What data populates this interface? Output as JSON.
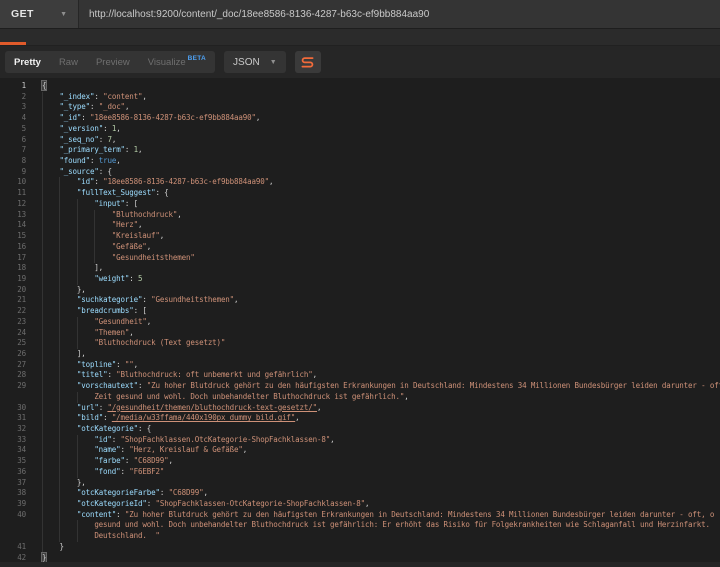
{
  "request": {
    "method": "GET",
    "url": "http://localhost:9200/content/_doc/18ee8586-8136-4287-b63c-ef9bb884aa90"
  },
  "response_toolbar": {
    "tabs": [
      {
        "label": "Pretty",
        "active": true
      },
      {
        "label": "Raw"
      },
      {
        "label": "Preview"
      },
      {
        "label": "Visualize",
        "badge": "BETA"
      }
    ],
    "format": "JSON",
    "beautify_icon": "beautify-icon"
  },
  "colors": {
    "accent_orange": "#e05b2b",
    "beta_blue": "#4ea1f3",
    "json_key": "#9cdcfe",
    "json_string": "#ce9178",
    "json_number": "#b5cea8",
    "json_boolean": "#569cd6",
    "otc_farbe_value": "C68D99",
    "otc_fond_value": "F6EBF2"
  },
  "editor": {
    "rows": [
      {
        "n": "1",
        "ind": 0,
        "active": true,
        "seg": [
          [
            "pm",
            "{"
          ]
        ]
      },
      {
        "n": "2",
        "ind": 1,
        "seg": [
          [
            "k",
            "\"_index\""
          ],
          [
            "p",
            ": "
          ],
          [
            "s",
            "\"content\""
          ],
          [
            "p",
            ","
          ]
        ]
      },
      {
        "n": "3",
        "ind": 1,
        "seg": [
          [
            "k",
            "\"_type\""
          ],
          [
            "p",
            ": "
          ],
          [
            "s",
            "\"_doc\""
          ],
          [
            "p",
            ","
          ]
        ]
      },
      {
        "n": "4",
        "ind": 1,
        "seg": [
          [
            "k",
            "\"_id\""
          ],
          [
            "p",
            ": "
          ],
          [
            "s",
            "\"18ee8586-8136-4287-b63c-ef9bb884aa90\""
          ],
          [
            "p",
            ","
          ]
        ]
      },
      {
        "n": "5",
        "ind": 1,
        "seg": [
          [
            "k",
            "\"_version\""
          ],
          [
            "p",
            ": "
          ],
          [
            "n",
            "1"
          ],
          [
            "p",
            ","
          ]
        ]
      },
      {
        "n": "6",
        "ind": 1,
        "seg": [
          [
            "k",
            "\"_seq_no\""
          ],
          [
            "p",
            ": "
          ],
          [
            "n",
            "7"
          ],
          [
            "p",
            ","
          ]
        ]
      },
      {
        "n": "7",
        "ind": 1,
        "seg": [
          [
            "k",
            "\"_primary_term\""
          ],
          [
            "p",
            ": "
          ],
          [
            "n",
            "1"
          ],
          [
            "p",
            ","
          ]
        ]
      },
      {
        "n": "8",
        "ind": 1,
        "seg": [
          [
            "k",
            "\"found\""
          ],
          [
            "p",
            ": "
          ],
          [
            "b",
            "true"
          ],
          [
            "p",
            ","
          ]
        ]
      },
      {
        "n": "9",
        "ind": 1,
        "seg": [
          [
            "k",
            "\"_source\""
          ],
          [
            "p",
            ": {"
          ]
        ]
      },
      {
        "n": "10",
        "ind": 2,
        "seg": [
          [
            "k",
            "\"id\""
          ],
          [
            "p",
            ": "
          ],
          [
            "s",
            "\"18ee8586-8136-4287-b63c-ef9bb884aa90\""
          ],
          [
            "p",
            ","
          ]
        ]
      },
      {
        "n": "11",
        "ind": 2,
        "seg": [
          [
            "k",
            "\"fullText_Suggest\""
          ],
          [
            "p",
            ": {"
          ]
        ]
      },
      {
        "n": "12",
        "ind": 3,
        "seg": [
          [
            "k",
            "\"input\""
          ],
          [
            "p",
            ": ["
          ]
        ]
      },
      {
        "n": "13",
        "ind": 4,
        "seg": [
          [
            "s",
            "\"Bluthochdruck\""
          ],
          [
            "p",
            ","
          ]
        ]
      },
      {
        "n": "14",
        "ind": 4,
        "seg": [
          [
            "s",
            "\"Herz\""
          ],
          [
            "p",
            ","
          ]
        ]
      },
      {
        "n": "15",
        "ind": 4,
        "seg": [
          [
            "s",
            "\"Kreislauf\""
          ],
          [
            "p",
            ","
          ]
        ]
      },
      {
        "n": "16",
        "ind": 4,
        "seg": [
          [
            "s",
            "\"Gefäße\""
          ],
          [
            "p",
            ","
          ]
        ]
      },
      {
        "n": "17",
        "ind": 4,
        "seg": [
          [
            "s",
            "\"Gesundheitsthemen\""
          ]
        ]
      },
      {
        "n": "18",
        "ind": 3,
        "seg": [
          [
            "p",
            "],"
          ]
        ]
      },
      {
        "n": "19",
        "ind": 3,
        "seg": [
          [
            "k",
            "\"weight\""
          ],
          [
            "p",
            ": "
          ],
          [
            "n",
            "5"
          ]
        ]
      },
      {
        "n": "20",
        "ind": 2,
        "seg": [
          [
            "p",
            "},"
          ]
        ]
      },
      {
        "n": "21",
        "ind": 2,
        "seg": [
          [
            "k",
            "\"suchkategorie\""
          ],
          [
            "p",
            ": "
          ],
          [
            "s",
            "\"Gesundheitsthemen\""
          ],
          [
            "p",
            ","
          ]
        ]
      },
      {
        "n": "22",
        "ind": 2,
        "seg": [
          [
            "k",
            "\"breadcrumbs\""
          ],
          [
            "p",
            ": ["
          ]
        ]
      },
      {
        "n": "23",
        "ind": 3,
        "seg": [
          [
            "s",
            "\"Gesundheit\""
          ],
          [
            "p",
            ","
          ]
        ]
      },
      {
        "n": "24",
        "ind": 3,
        "seg": [
          [
            "s",
            "\"Themen\""
          ],
          [
            "p",
            ","
          ]
        ]
      },
      {
        "n": "25",
        "ind": 3,
        "seg": [
          [
            "s",
            "\"Bluthochdruck (Text gesetzt)\""
          ]
        ]
      },
      {
        "n": "26",
        "ind": 2,
        "seg": [
          [
            "p",
            "],"
          ]
        ]
      },
      {
        "n": "27",
        "ind": 2,
        "seg": [
          [
            "k",
            "\"topline\""
          ],
          [
            "p",
            ": "
          ],
          [
            "s",
            "\"\""
          ],
          [
            "p",
            ","
          ]
        ]
      },
      {
        "n": "28",
        "ind": 2,
        "seg": [
          [
            "k",
            "\"titel\""
          ],
          [
            "p",
            ": "
          ],
          [
            "s",
            "\"Bluthochdruck: oft unbemerkt und gefährlich\""
          ],
          [
            "p",
            ","
          ]
        ]
      },
      {
        "n": "29",
        "ind": 2,
        "seg": [
          [
            "k",
            "\"vorschautext\""
          ],
          [
            "p",
            ": "
          ],
          [
            "s",
            "\"Zu hoher Blutdruck gehört zu den häufigsten Erkrankungen in Deutschland: Mindestens 34 Millionen Bundesbürger leiden darunter - oft"
          ]
        ]
      },
      {
        "n": "",
        "ind": 3,
        "seg": [
          [
            "s",
            "Zeit gesund und wohl. Doch unbehandelter Bluthochdruck ist gefährlich.\""
          ],
          [
            "p",
            ","
          ]
        ]
      },
      {
        "n": "30",
        "ind": 2,
        "seg": [
          [
            "k",
            "\"url\""
          ],
          [
            "p",
            ": "
          ],
          [
            "u",
            "\"/gesundheit/themen/bluthochdruck-text-gesetzt/\""
          ],
          [
            "p",
            ","
          ]
        ]
      },
      {
        "n": "31",
        "ind": 2,
        "seg": [
          [
            "k",
            "\"bild\""
          ],
          [
            "p",
            ": "
          ],
          [
            "u",
            "\"/media/w33ffama/440x190px_dummy_bild.gif\""
          ],
          [
            "p",
            ","
          ]
        ]
      },
      {
        "n": "32",
        "ind": 2,
        "seg": [
          [
            "k",
            "\"otcKategorie\""
          ],
          [
            "p",
            ": {"
          ]
        ]
      },
      {
        "n": "33",
        "ind": 3,
        "seg": [
          [
            "k",
            "\"id\""
          ],
          [
            "p",
            ": "
          ],
          [
            "s",
            "\"ShopFachklassen.OtcKategorie-ShopFachklassen-8\""
          ],
          [
            "p",
            ","
          ]
        ]
      },
      {
        "n": "34",
        "ind": 3,
        "seg": [
          [
            "k",
            "\"name\""
          ],
          [
            "p",
            ": "
          ],
          [
            "s",
            "\"Herz, Kreislauf & Gefäße\""
          ],
          [
            "p",
            ","
          ]
        ]
      },
      {
        "n": "35",
        "ind": 3,
        "seg": [
          [
            "k",
            "\"farbe\""
          ],
          [
            "p",
            ": "
          ],
          [
            "s",
            "\"C68D99\""
          ],
          [
            "p",
            ","
          ]
        ]
      },
      {
        "n": "36",
        "ind": 3,
        "seg": [
          [
            "k",
            "\"fond\""
          ],
          [
            "p",
            ": "
          ],
          [
            "s",
            "\"F6EBF2\""
          ]
        ]
      },
      {
        "n": "37",
        "ind": 2,
        "seg": [
          [
            "p",
            "},"
          ]
        ]
      },
      {
        "n": "38",
        "ind": 2,
        "seg": [
          [
            "k",
            "\"otcKategorieFarbe\""
          ],
          [
            "p",
            ": "
          ],
          [
            "s",
            "\"C68D99\""
          ],
          [
            "p",
            ","
          ]
        ]
      },
      {
        "n": "39",
        "ind": 2,
        "seg": [
          [
            "k",
            "\"otcKategorieId\""
          ],
          [
            "p",
            ": "
          ],
          [
            "s",
            "\"ShopFachklassen-OtcKategorie-ShopFachklassen-8\""
          ],
          [
            "p",
            ","
          ]
        ]
      },
      {
        "n": "40",
        "ind": 2,
        "seg": [
          [
            "k",
            "\"content\""
          ],
          [
            "p",
            ": "
          ],
          [
            "s",
            "\"Zu hoher Blutdruck gehört zu den häufigsten Erkrankungen in Deutschland: Mindestens 34 Millionen Bundesbürger leiden darunter - oft, o"
          ]
        ]
      },
      {
        "n": "",
        "ind": 3,
        "seg": [
          [
            "s",
            "gesund und wohl. Doch unbehandelter Bluthochdruck ist gefährlich: Er erhöht das Risiko für Folgekrankheiten wie Schlaganfall und Herzinfarkt."
          ]
        ]
      },
      {
        "n": "",
        "ind": 3,
        "seg": [
          [
            "s",
            "Deutschland.  \""
          ]
        ]
      },
      {
        "n": "41",
        "ind": 1,
        "seg": [
          [
            "p",
            "}"
          ]
        ]
      },
      {
        "n": "42",
        "ind": 0,
        "seg": [
          [
            "pm",
            "}"
          ]
        ]
      }
    ]
  }
}
